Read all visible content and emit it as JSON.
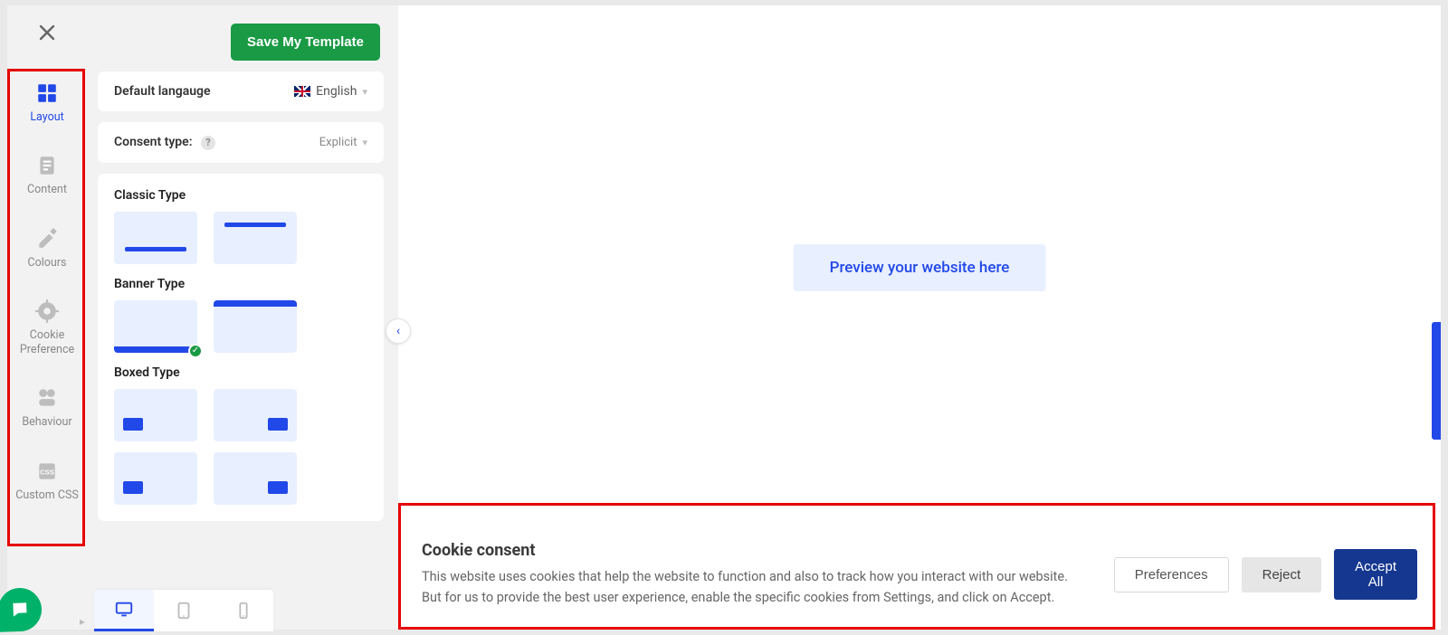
{
  "actions": {
    "save": "Save My Template"
  },
  "sidebar": {
    "items": [
      {
        "label": "Layout"
      },
      {
        "label": "Content"
      },
      {
        "label": "Colours"
      },
      {
        "label": "Cookie Preference"
      },
      {
        "label": "Behaviour"
      },
      {
        "label": "Custom CSS"
      }
    ]
  },
  "settings": {
    "language_label": "Default langauge",
    "language_value": "English",
    "consent_label": "Consent type:",
    "consent_value": "Explicit"
  },
  "layouts": {
    "classic_title": "Classic Type",
    "banner_title": "Banner Type",
    "boxed_title": "Boxed Type"
  },
  "preview": {
    "button": "Preview your website here"
  },
  "cookie_banner": {
    "title": "Cookie consent",
    "desc": "This website uses cookies that help the website to function and also to track how you interact with our website. But for us to provide the best user experience, enable the specific cookies from Settings, and click on Accept.",
    "preferences": "Preferences",
    "reject": "Reject",
    "accept": "Accept All"
  }
}
